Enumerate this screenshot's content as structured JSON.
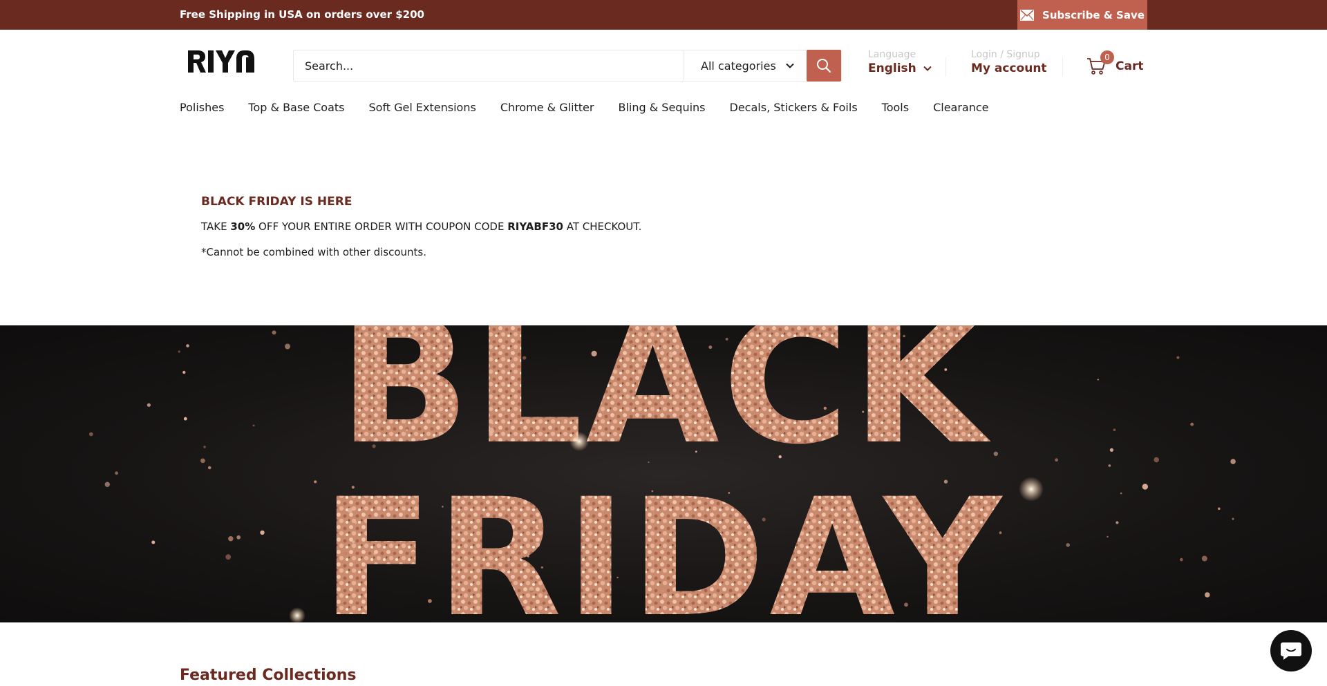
{
  "topbar": {
    "shipping_text": "Free Shipping in USA on orders over $200",
    "subscribe_label": "Subscribe & Save",
    "bg_color": "#6b2a20",
    "accent_color": "#c0614f"
  },
  "header": {
    "logo_alt": "RIYA",
    "search_placeholder": "Search...",
    "category_selected": "All categories",
    "language_caption": "Language",
    "language_value": "English",
    "account_caption": "Login / Signup",
    "account_label": "My account",
    "cart_count": "0",
    "cart_label": "Cart"
  },
  "nav": {
    "items": [
      {
        "label": "Polishes"
      },
      {
        "label": "Top & Base Coats"
      },
      {
        "label": "Soft Gel Extensions"
      },
      {
        "label": "Chrome & Glitter"
      },
      {
        "label": "Bling & Sequins"
      },
      {
        "label": "Decals, Stickers & Foils"
      },
      {
        "label": "Tools"
      },
      {
        "label": "Clearance"
      }
    ]
  },
  "promo": {
    "heading": "BLACK FRIDAY IS HERE",
    "line1_a": "TAKE ",
    "line1_b": "30%",
    "line1_c": " OFF YOUR ENTIRE ORDER WITH COUPON CODE ",
    "line1_d": "RIYABF30",
    "line1_e": " AT CHECKOUT.",
    "line2": "*Cannot be combined with other discounts."
  },
  "banner": {
    "word1": "BLACK",
    "word2": "FRIDAY",
    "glitter_color": "#d9967a"
  },
  "featured": {
    "title": "Featured Collections"
  },
  "icons": {
    "mail": "mail-icon",
    "search": "search-icon",
    "chevron": "chevron-down-icon",
    "cart": "cart-icon",
    "chat": "chat-icon"
  }
}
